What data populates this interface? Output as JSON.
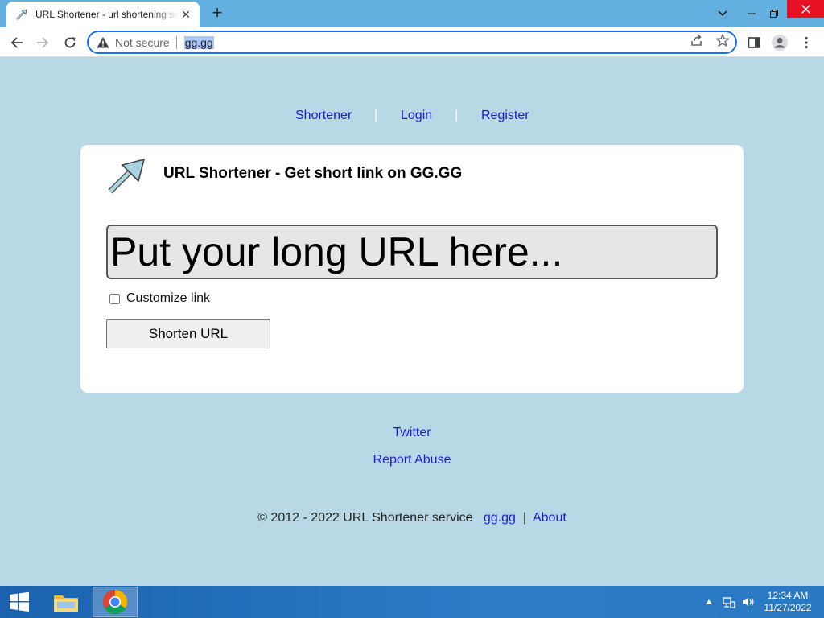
{
  "browser": {
    "tab_title": "URL Shortener - url shortening service",
    "tab_close": "✕",
    "new_tab": "+",
    "security_text": "Not secure",
    "url": "gg.gg",
    "accent": "#1a73e8"
  },
  "nav": {
    "shortener": "Shortener",
    "sep1": "|",
    "login": "Login",
    "sep2": "|",
    "register": "Register"
  },
  "card": {
    "title": "URL Shortener - Get short link on GG.GG",
    "input_placeholder": "Put your long URL here...",
    "input_value": "",
    "customize_label": "Customize link",
    "customize_checked": false,
    "shorten_label": "Shorten URL"
  },
  "links": {
    "twitter": "Twitter",
    "report_abuse": "Report Abuse"
  },
  "footer": {
    "copyright": "© 2012 - 2022 URL Shortener service",
    "site_link": "gg.gg",
    "sep": "|",
    "about": "About"
  },
  "taskbar": {
    "time": "12:34 AM",
    "date": "11/27/2022"
  },
  "colors": {
    "page_bg": "#b9d8e5",
    "link": "#1a1ad6",
    "card_bg": "#ffffff"
  }
}
